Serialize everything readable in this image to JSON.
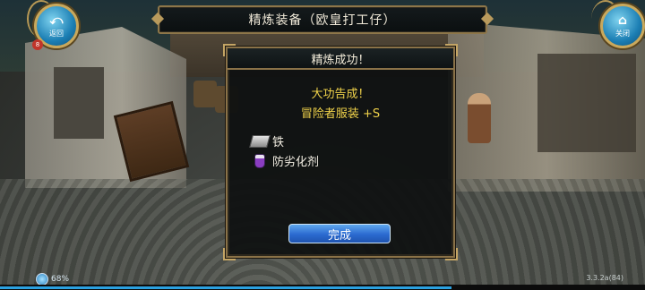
{
  "window": {
    "title": "精炼装备（欧皇打工仔）"
  },
  "nav": {
    "back": {
      "label": "返回",
      "icon": "back-arrow-icon"
    },
    "close": {
      "label": "关闭",
      "icon": "home-icon"
    },
    "badge": "8"
  },
  "dialog": {
    "title": "精炼成功！",
    "message": "大功告成！",
    "result_item": "冒险者服装 +S",
    "materials": [
      {
        "icon": "iron-ingot-icon",
        "name": "铁"
      },
      {
        "icon": "potion-icon",
        "name": "防劣化剂"
      }
    ],
    "confirm_label": "完成"
  },
  "status": {
    "battery_percent": "68%",
    "version": "3.3.2a(84)"
  },
  "colors": {
    "accent_gold": "#8a7248",
    "message_yellow": "#f0d24a",
    "button_blue": "#2b6ad0"
  }
}
